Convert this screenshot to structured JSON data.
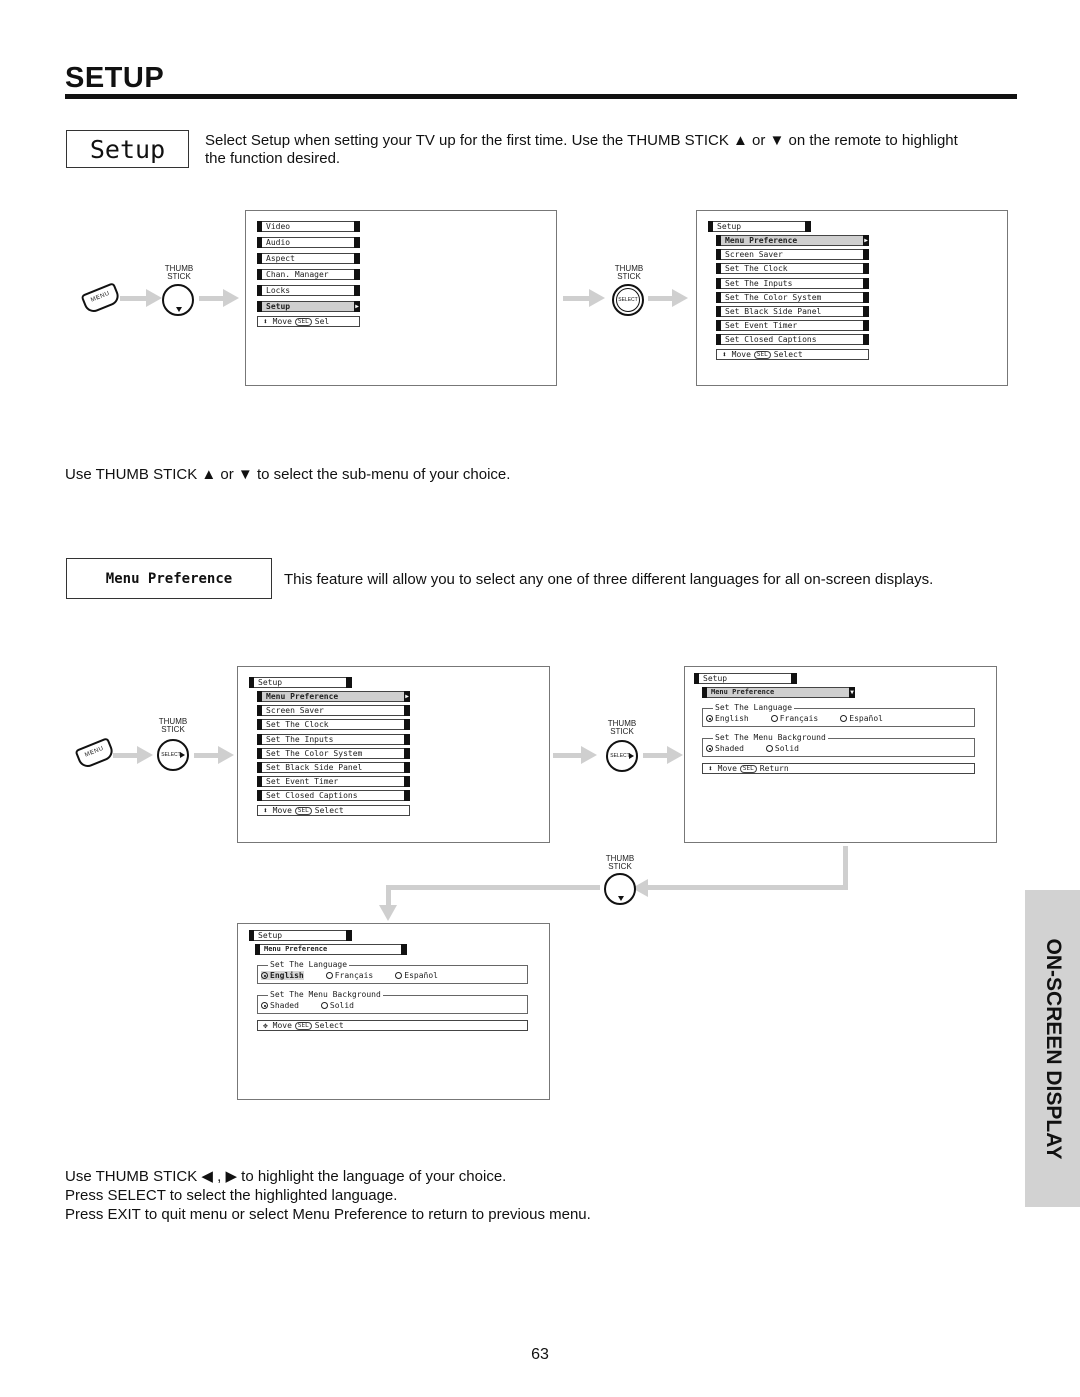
{
  "page": {
    "heading": "SETUP",
    "side_tab": "ON-SCREEN DISPLAY",
    "page_number": "63"
  },
  "section_setup": {
    "label": "Setup",
    "description_line1": "Select Setup when setting your TV up for the first time.  Use the THUMB STICK ▲ or ▼ on the remote to highlight",
    "description_line2": "the function desired.",
    "instruction": "Use THUMB STICK ▲ or ▼ to select the sub-menu of your choice."
  },
  "section_menu_pref": {
    "label": "Menu Preference",
    "description": "This feature will allow you to select any one of three different languages for all on-screen displays.",
    "instructions": [
      "Use THUMB STICK ◀ , ▶ to highlight the language of your choice.",
      "Press SELECT to select the highlighted language.",
      "Press EXIT to quit menu or select Menu Preference to return to previous menu."
    ]
  },
  "remote": {
    "menu_button": "MENU",
    "thumb_stick_line1": "THUMB",
    "thumb_stick_line2": "STICK",
    "select": "SELECT"
  },
  "screen_main_menu": {
    "items": [
      "Video",
      "Audio",
      "Aspect",
      "Chan. Manager",
      "Locks",
      "Setup"
    ],
    "selected": "Setup",
    "hint_move": "Move",
    "hint_sel": "SEL",
    "hint_action": "Sel"
  },
  "screen_setup_menu": {
    "title": "Setup",
    "items": [
      "Menu Preference",
      "Screen Saver",
      "Set The Clock",
      "Set The Inputs",
      "Set The Color System",
      "Set Black Side Panel",
      "Set Event Timer",
      "Set Closed Captions"
    ],
    "selected": "Menu Preference",
    "hint_move": "Move",
    "hint_sel": "SEL",
    "hint_action": "Select"
  },
  "screen_menu_pref": {
    "title": "Setup",
    "submenu": "Menu Preference",
    "language_group": "Set The Language",
    "languages": [
      "English",
      "Français",
      "Español"
    ],
    "language_selected": "English",
    "background_group": "Set The Menu Background",
    "backgrounds": [
      "Shaded",
      "Solid"
    ],
    "background_selected": "Shaded",
    "hint_move": "Move",
    "hint_sel": "SEL",
    "hint_action_return": "Return",
    "hint_action_select": "Select"
  }
}
